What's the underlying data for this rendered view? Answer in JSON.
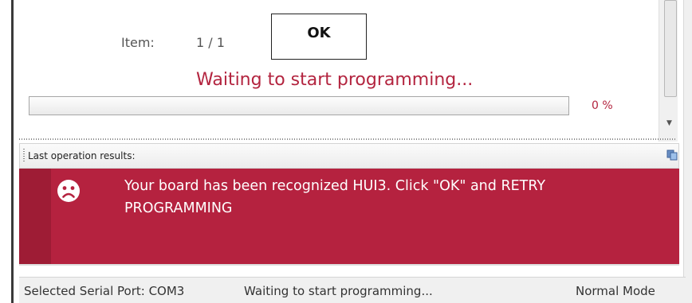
{
  "item": {
    "label": "Item:",
    "value": "1 / 1"
  },
  "ok_button": {
    "label": "OK"
  },
  "status_message": "Waiting to start programming...",
  "progress": {
    "percent_label": "0 %",
    "value": 0
  },
  "results": {
    "title": "Last operation results:"
  },
  "error": {
    "message": "Your board has been recognized  HUI3. Click \"OK\" and RETRY PROGRAMMING",
    "color": "#b5223f"
  },
  "statusbar": {
    "port": "Selected Serial Port: COM3",
    "status": "Waiting to start programming...",
    "mode": "Normal Mode"
  },
  "icons": [
    "sad-face-icon",
    "copy-icon",
    "scroll-down-icon"
  ]
}
